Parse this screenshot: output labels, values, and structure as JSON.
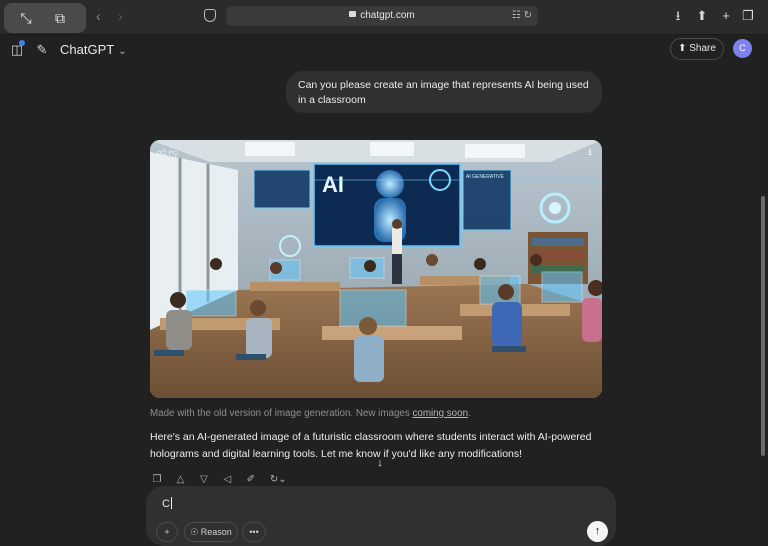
{
  "browser": {
    "url": "chatgpt.com",
    "icons": {
      "resize": "resize-icon",
      "pip": "picture-in-picture-icon",
      "back": "back-icon",
      "forward": "forward-icon",
      "shield": "shield-icon",
      "lock": "lock-icon",
      "translate": "translate-icon",
      "reload": "reload-icon",
      "download": "download-icon",
      "share": "share-icon",
      "new_tab": "plus-icon",
      "tabs": "tabs-icon"
    }
  },
  "header": {
    "title": "ChatGPT",
    "share_label": "Share",
    "avatar_initial": "C"
  },
  "conversation": {
    "user_message": "Can you please create an image that represents AI being used in a classroom",
    "image_alt_text_visible": {
      "board_text": "AI",
      "panel_text": "AI GENERATIVE"
    },
    "caption_prefix": "Made with the old version of image generation. New images ",
    "caption_link": "coming soon",
    "caption_suffix": ".",
    "reply": "Here's an AI-generated image of a futuristic classroom where students interact with AI-powered holograms and digital learning tools. Let me know if you'd like any modifications!"
  },
  "composer": {
    "value": "C",
    "reason_label": "Reason",
    "more_label": "•••"
  },
  "colors": {
    "background": "#212121",
    "bubble": "#303030",
    "accent_avatar": "#7c83ee",
    "hologram": "#5ec8ff"
  }
}
